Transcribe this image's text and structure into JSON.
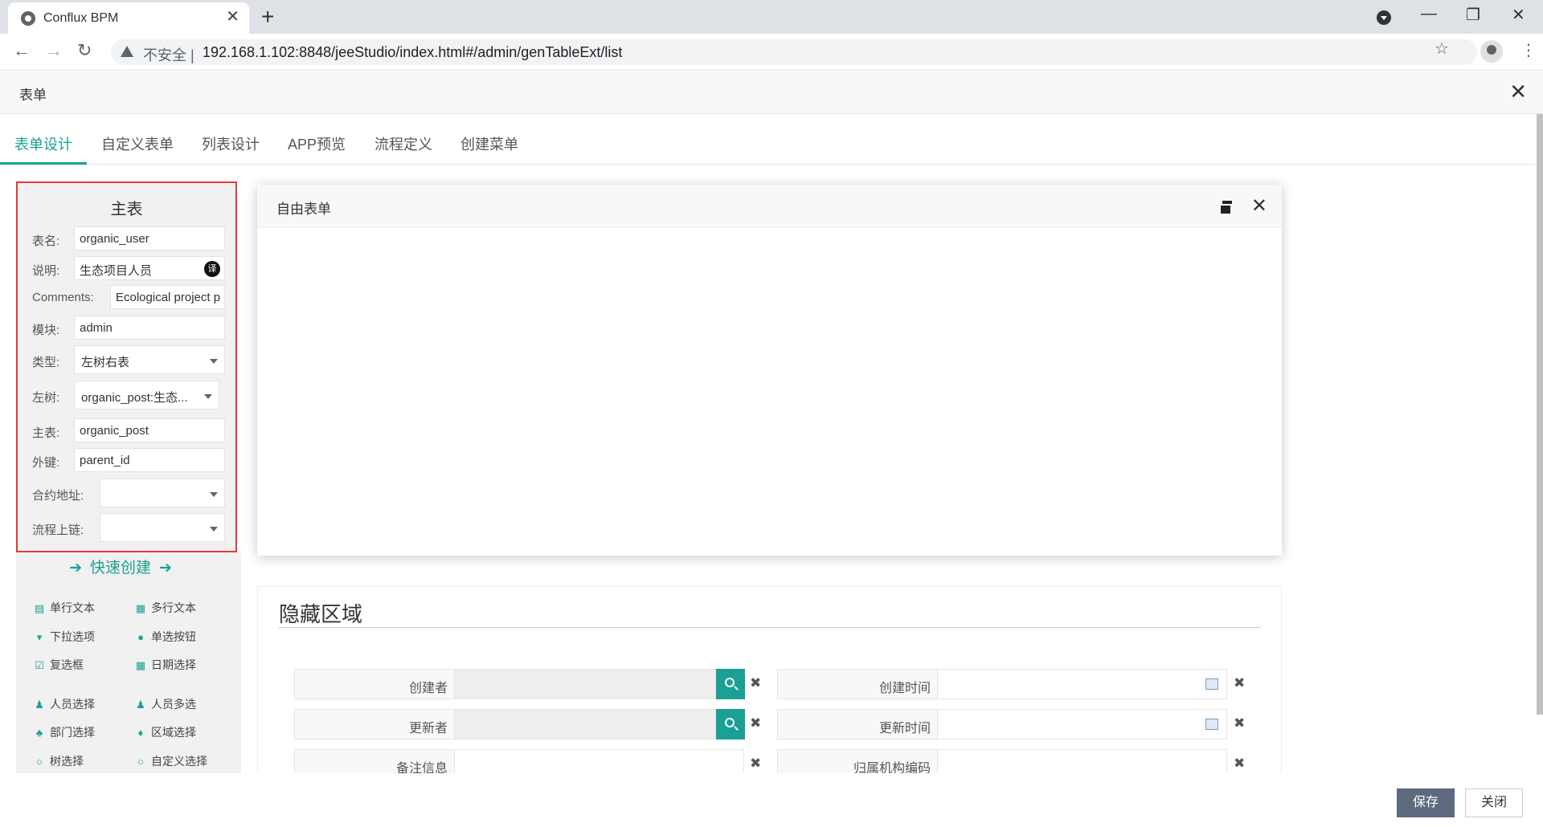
{
  "browser": {
    "tab_title": "Conflux BPM",
    "tab_close": "✕",
    "new_tab": "+",
    "insecure_label": "不安全 |",
    "url": "192.168.1.102:8848/jeeStudio/index.html#/admin/genTableExt/list",
    "back": "←",
    "forward": "→",
    "reload": "↻",
    "star": "☆",
    "menu": "⋮",
    "minimize": "—",
    "restore": "❐",
    "close": "✕"
  },
  "app": {
    "title": "表单",
    "close": "✕"
  },
  "tabs": [
    "表单设计",
    "自定义表单",
    "列表设计",
    "APP预览",
    "流程定义",
    "创建菜单"
  ],
  "main_table": {
    "title": "主表",
    "fields": {
      "table_name": {
        "label": "表名:",
        "value": "organic_user"
      },
      "description": {
        "label": "说明:",
        "value": "生态项目人员",
        "translate": "译"
      },
      "comments": {
        "label": "Comments:",
        "value": "Ecological project p"
      },
      "module": {
        "label": "模块:",
        "value": "admin"
      },
      "type": {
        "label": "类型:",
        "value": "左树右表"
      },
      "left_tree": {
        "label": "左树:",
        "value": "organic_post:生态..."
      },
      "master_table": {
        "label": "主表:",
        "value": "organic_post"
      },
      "foreign_key": {
        "label": "外键:",
        "value": "parent_id"
      },
      "contract_address": {
        "label": "合约地址:",
        "value": ""
      },
      "process_chain": {
        "label": "流程上链:",
        "value": ""
      }
    }
  },
  "quick_create": {
    "label": "快速创建",
    "components": [
      {
        "label": "单行文本",
        "icon": "file-icon",
        "glyph": "▤"
      },
      {
        "label": "多行文本",
        "icon": "file-text-icon",
        "glyph": "▦"
      },
      {
        "label": "下拉选项",
        "icon": "caret-down-icon",
        "glyph": "▾"
      },
      {
        "label": "单选按钮",
        "icon": "check-circle-icon",
        "glyph": "●"
      },
      {
        "label": "复选框",
        "icon": "checkbox-icon",
        "glyph": "☑"
      },
      {
        "label": "日期选择",
        "icon": "calendar-icon",
        "glyph": "▦"
      },
      {
        "label": "人员选择",
        "icon": "user-icon",
        "glyph": "♟"
      },
      {
        "label": "人员多选",
        "icon": "users-icon",
        "glyph": "♟"
      },
      {
        "label": "部门选择",
        "icon": "sitemap-icon",
        "glyph": "♣"
      },
      {
        "label": "区域选择",
        "icon": "map-pin-icon",
        "glyph": "♦"
      },
      {
        "label": "树选择",
        "icon": "search-icon",
        "glyph": "○"
      },
      {
        "label": "自定义选择",
        "icon": "search-icon",
        "glyph": "○"
      }
    ]
  },
  "free_form": {
    "title": "自由表单",
    "close": "✕"
  },
  "hidden_area": {
    "title": "隐藏区域",
    "rows": [
      {
        "label": "创建者",
        "type": "user-select"
      },
      {
        "label": "创建时间",
        "type": "date"
      },
      {
        "label": "更新者",
        "type": "user-select"
      },
      {
        "label": "更新时间",
        "type": "date"
      },
      {
        "label": "备注信息",
        "type": "text"
      },
      {
        "label": "归属机构编码",
        "type": "text"
      }
    ],
    "clear": "✖"
  },
  "footer": {
    "save": "保存",
    "close": "关闭"
  },
  "colors": {
    "accent": "#1aa094",
    "highlight_border": "#e53935",
    "save_button": "#5d6a7e"
  }
}
